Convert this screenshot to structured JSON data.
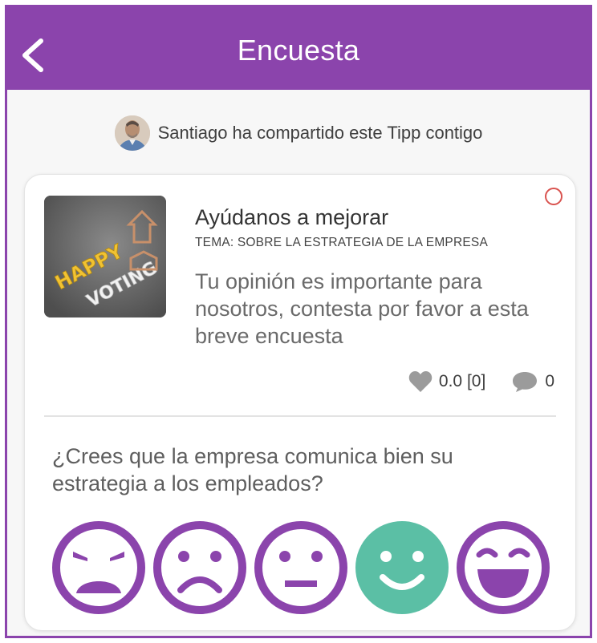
{
  "header": {
    "title": "Encuesta"
  },
  "share": {
    "text": "Santiago ha compartido este Tipp contigo"
  },
  "tipp": {
    "title": "Ayúdanos a mejorar",
    "topic": "TEMA: SOBRE LA ESTRATEGIA DE LA EMPRESA",
    "description": "Tu opinión es importante para nosotros, contesta por favor a esta breve encuesta",
    "rating": "0.0 [0]",
    "comments": "0",
    "thumbnail_text": [
      "HAPPY",
      "VOTING"
    ]
  },
  "survey": {
    "question": "¿Crees que la empresa comunica bien su estrategia a los empleados?",
    "options": [
      {
        "name": "very-unhappy",
        "selected": false
      },
      {
        "name": "unhappy",
        "selected": false
      },
      {
        "name": "neutral",
        "selected": false
      },
      {
        "name": "happy",
        "selected": true
      },
      {
        "name": "very-happy",
        "selected": false
      }
    ]
  },
  "colors": {
    "brand": "#8b44ac",
    "selected": "#5bbfa5",
    "status": "#d9534f",
    "face_outline": "#8b44ac"
  },
  "icons": {
    "back": "chevron-left-icon",
    "status": "circle-outline-icon",
    "rating": "heart-icon",
    "comments": "speech-bubble-icon"
  }
}
